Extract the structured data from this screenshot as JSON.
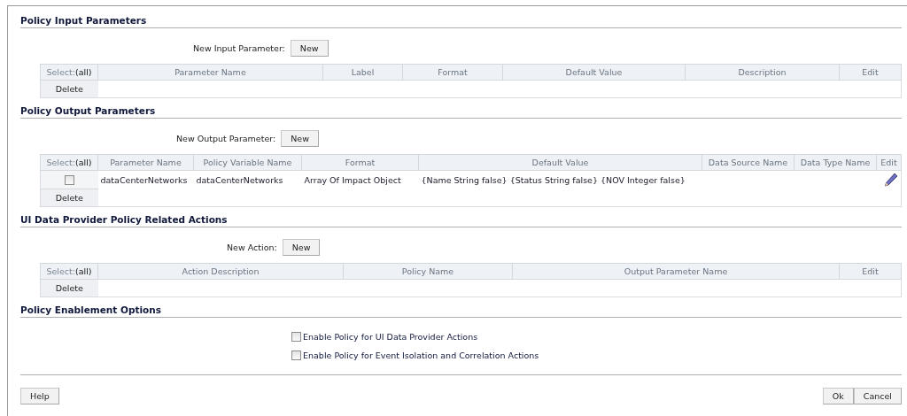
{
  "sections": [
    {
      "title": "Policy Input Parameters",
      "kind": "table",
      "new_label": "New Input Parameter:",
      "new_button": "New",
      "table": {
        "select_label": "Select:",
        "select_all": "(all)",
        "columns": [
          "Parameter Name",
          "Label",
          "Format",
          "Default Value",
          "Description",
          "Edit"
        ],
        "delete_button": "Delete"
      }
    },
    {
      "title": "Policy Output Parameters",
      "kind": "table",
      "new_label": "New Output Parameter:",
      "new_button": "New",
      "table": {
        "select_label": "Select:",
        "select_all": "(all)",
        "columns": [
          "Parameter Name",
          "Policy Variable Name",
          "Format",
          "Default Value",
          "Data Source Name",
          "Data Type Name",
          "Edit"
        ],
        "rows": [
          {
            "checked": false,
            "cells": [
              "dataCenterNetworks",
              "dataCenterNetworks",
              "Array Of Impact Object",
              "{Name String false} {Status String false} {NOV Integer false}"
            ]
          }
        ],
        "delete_button": "Delete"
      }
    },
    {
      "title": "UI Data Provider Policy Related Actions",
      "kind": "table",
      "new_label": "New Action:",
      "new_button": "New",
      "table": {
        "select_label": "Select:",
        "select_all": "(all)",
        "columns": [
          "Action Description",
          "Policy Name",
          "Output Parameter Name",
          "Edit"
        ],
        "delete_button": "Delete"
      }
    },
    {
      "title": "Policy Enablement Options",
      "kind": "options",
      "options": [
        {
          "label": "Enable Policy for UI Data Provider Actions",
          "checked": false
        },
        {
          "label": "Enable Policy for Event Isolation and Correlation Actions",
          "checked": false
        }
      ]
    }
  ],
  "footer": {
    "help": "Help",
    "ok": "Ok",
    "cancel": "Cancel"
  }
}
